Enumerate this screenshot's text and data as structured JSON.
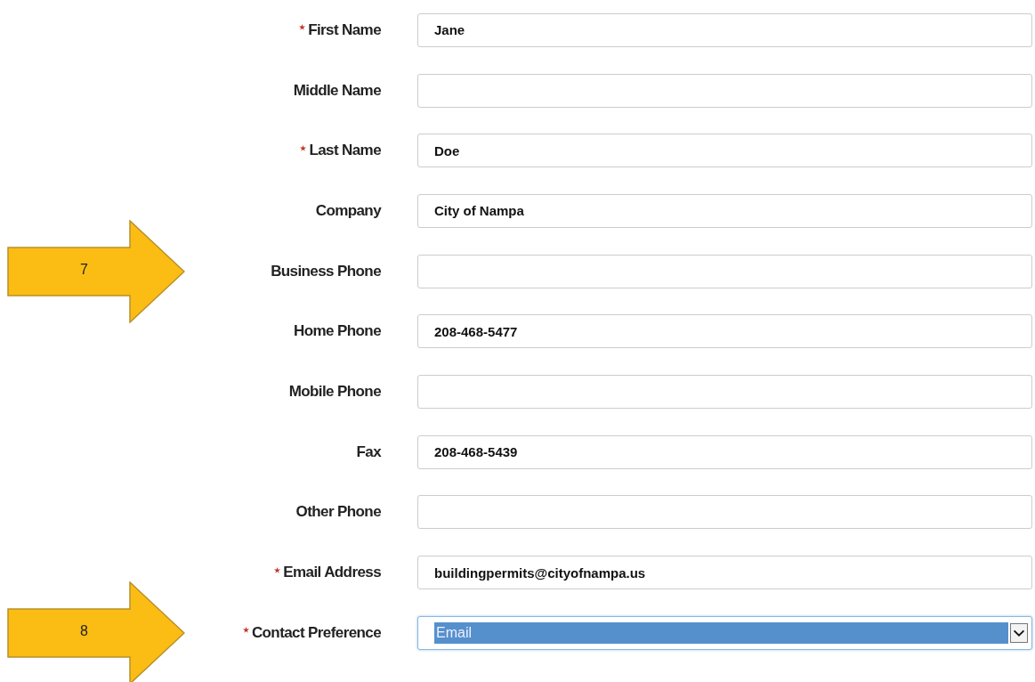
{
  "fields": [
    {
      "label": "First Name",
      "required": true,
      "kind": "text",
      "value": "Jane",
      "focused": false
    },
    {
      "label": "Middle Name",
      "required": false,
      "kind": "text",
      "focused": false
    },
    {
      "label": "Last Name",
      "required": true,
      "kind": "text",
      "value": "Doe",
      "focused": false
    },
    {
      "label": "Company",
      "required": false,
      "kind": "text",
      "value": "City of Nampa",
      "focused": false
    },
    {
      "label": "Business Phone",
      "required": false,
      "kind": "text",
      "focused": false,
      "callout": "7"
    },
    {
      "label": "Home Phone",
      "required": false,
      "kind": "text",
      "value": "208-468-5477",
      "focused": false
    },
    {
      "label": "Mobile Phone",
      "required": false,
      "kind": "text",
      "focused": false
    },
    {
      "label": "Fax",
      "required": false,
      "kind": "text",
      "value": "208-468-5439",
      "focused": false
    },
    {
      "label": "Other Phone",
      "required": false,
      "kind": "text",
      "focused": false
    },
    {
      "label": "Email Address",
      "required": true,
      "kind": "text",
      "value": "buildingpermits@cityofnampa.us",
      "focused": false
    },
    {
      "label": "Contact Preference",
      "required": true,
      "kind": "select",
      "value": "Email",
      "focused": true,
      "callout": "8"
    }
  ]
}
